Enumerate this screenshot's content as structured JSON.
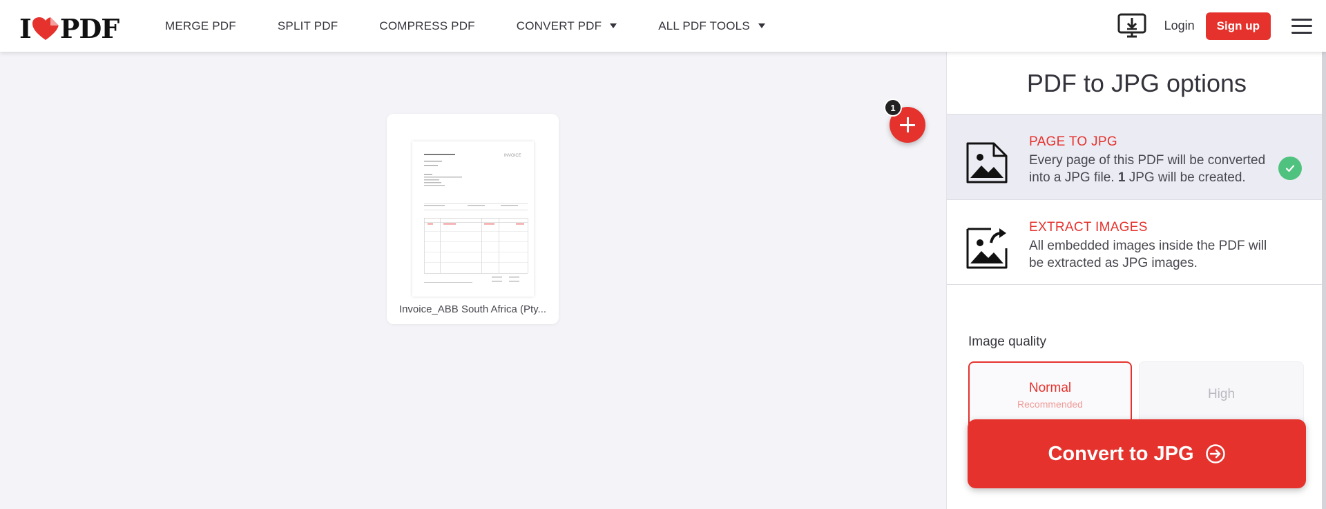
{
  "header": {
    "logo_left": "I",
    "logo_right": "PDF",
    "nav": [
      {
        "label": "MERGE PDF",
        "has_caret": false
      },
      {
        "label": "SPLIT PDF",
        "has_caret": false
      },
      {
        "label": "COMPRESS PDF",
        "has_caret": false
      },
      {
        "label": "CONVERT PDF",
        "has_caret": true
      },
      {
        "label": "ALL PDF TOOLS",
        "has_caret": true
      }
    ],
    "login_label": "Login",
    "signup_label": "Sign up"
  },
  "workspace": {
    "file_count": "1",
    "file_name": "Invoice_ABB South Africa (Pty...",
    "thumb_title": "INVOICE"
  },
  "sidebar": {
    "title": "PDF to JPG options",
    "options": [
      {
        "title": "PAGE TO JPG",
        "desc_before": "Every page of this PDF will be converted into a JPG file.",
        "desc_bold": "1",
        "desc_after": "JPG will be created.",
        "selected": true
      },
      {
        "title": "EXTRACT IMAGES",
        "desc": "All embedded images inside the PDF will be extracted as JPG images.",
        "selected": false
      }
    ],
    "quality_label": "Image quality",
    "quality_normal": "Normal",
    "quality_normal_sub": "Recommended",
    "quality_high": "High",
    "convert_label": "Convert to JPG"
  },
  "colors": {
    "brand_red": "#e5322d",
    "check_green": "#4ec27e",
    "selected_bg": "#ebebf3"
  }
}
